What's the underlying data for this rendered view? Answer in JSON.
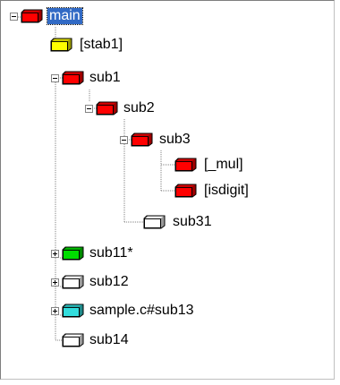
{
  "tree": {
    "nodes": [
      {
        "id": "main",
        "label": "main",
        "color": "#ff0000",
        "toggle": "expanded",
        "selected": true
      },
      {
        "id": "stab1",
        "label": "[stab1]",
        "color": "#ffff00",
        "toggle": "none",
        "selected": false
      },
      {
        "id": "sub1",
        "label": "sub1",
        "color": "#ff0000",
        "toggle": "expanded",
        "selected": false
      },
      {
        "id": "sub2",
        "label": "sub2",
        "color": "#ff0000",
        "toggle": "expanded",
        "selected": false
      },
      {
        "id": "sub3",
        "label": "sub3",
        "color": "#ff0000",
        "toggle": "expanded",
        "selected": false
      },
      {
        "id": "mul",
        "label": "[_mul]",
        "color": "#ff0000",
        "toggle": "none",
        "selected": false
      },
      {
        "id": "isdigit",
        "label": "[isdigit]",
        "color": "#ff0000",
        "toggle": "none",
        "selected": false
      },
      {
        "id": "sub31",
        "label": "sub31",
        "color": "#ffffff",
        "toggle": "none",
        "selected": false
      },
      {
        "id": "sub11",
        "label": "sub11*",
        "color": "#00dd00",
        "toggle": "collapsed",
        "selected": false
      },
      {
        "id": "sub12",
        "label": "sub12",
        "color": "#ffffff",
        "toggle": "collapsed",
        "selected": false
      },
      {
        "id": "sub13",
        "label": "sample.c#sub13",
        "color": "#33dddd",
        "toggle": "collapsed",
        "selected": false
      },
      {
        "id": "sub14",
        "label": "sub14",
        "color": "#ffffff",
        "toggle": "none",
        "selected": false
      }
    ]
  }
}
